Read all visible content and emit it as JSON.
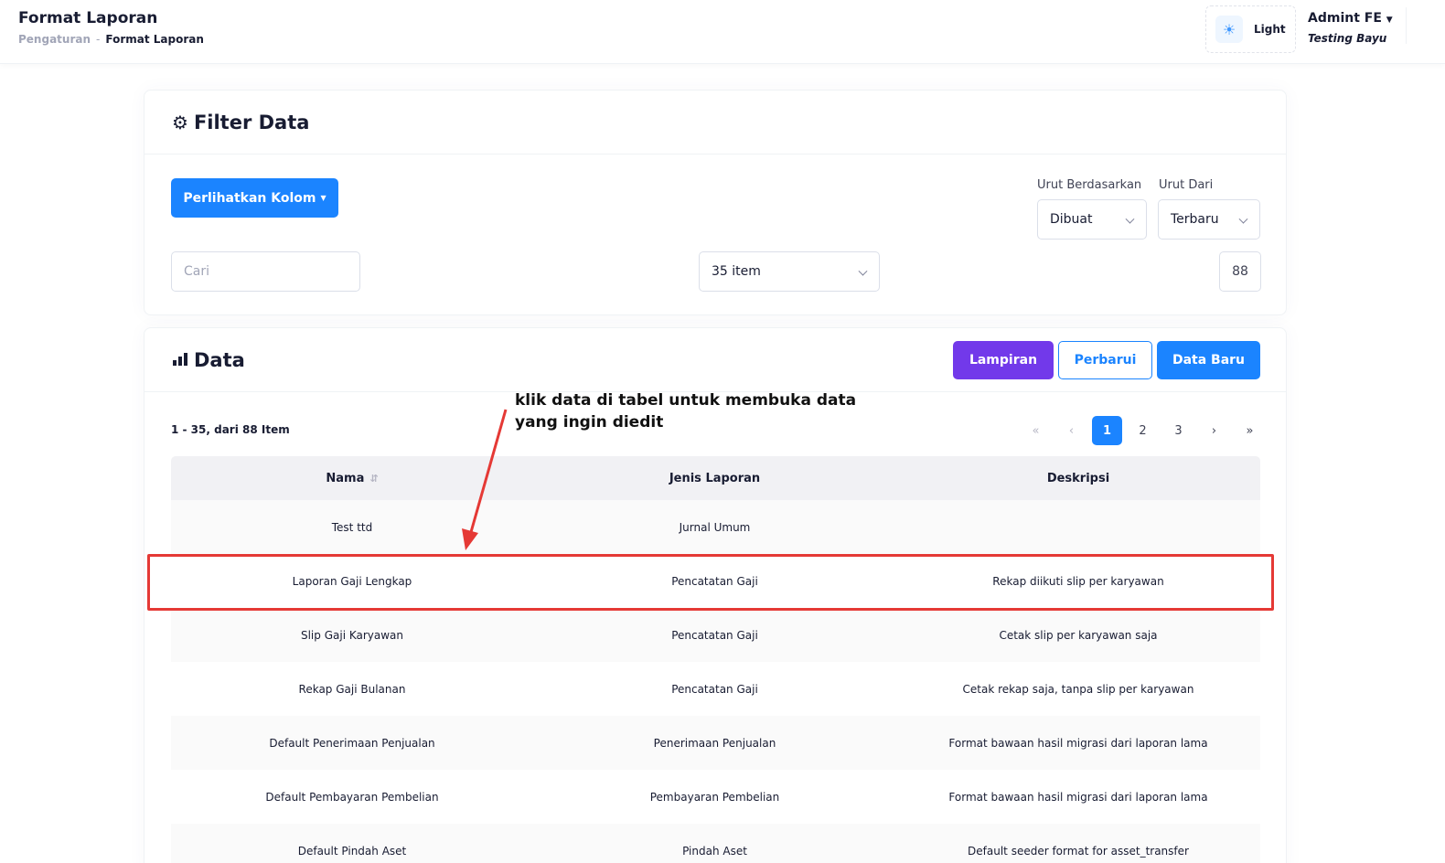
{
  "header": {
    "title": "Format Laporan",
    "breadcrumb": {
      "parent": "Pengaturan",
      "separator": "-",
      "current": "Format Laporan"
    },
    "theme": {
      "icon": "sun-icon",
      "label": "Light"
    },
    "user": {
      "name": "Admint FE",
      "subtitle": "Testing Bayu"
    }
  },
  "filter": {
    "title": "Filter Data",
    "icon": "gear-icon",
    "columns_button": "Perlihatkan Kolom",
    "sort_by": {
      "label": "Urut Berdasarkan",
      "value": "Dibuat"
    },
    "sort_order": {
      "label": "Urut Dari",
      "value": "Terbaru"
    },
    "search": {
      "placeholder": "Cari",
      "value": ""
    },
    "per_page": "35 item",
    "total": "88"
  },
  "data": {
    "title": "Data",
    "icon": "bar-chart-icon",
    "buttons": {
      "attachment": "Lampiran",
      "refresh": "Perbarui",
      "new": "Data Baru"
    },
    "range_text": "1 - 35, dari 88 Item",
    "pagination": {
      "first": "«",
      "prev": "‹",
      "pages": [
        "1",
        "2",
        "3"
      ],
      "active": "1",
      "next": "›",
      "last": "»"
    },
    "columns": [
      "Nama",
      "Jenis Laporan",
      "Deskripsi"
    ],
    "rows": [
      [
        "Test ttd",
        "Jurnal Umum",
        ""
      ],
      [
        "Laporan Gaji Lengkap",
        "Pencatatan Gaji",
        "Rekap diikuti slip per karyawan"
      ],
      [
        "Slip Gaji Karyawan",
        "Pencatatan Gaji",
        "Cetak slip per karyawan saja"
      ],
      [
        "Rekap Gaji Bulanan",
        "Pencatatan Gaji",
        "Cetak rekap saja, tanpa slip per karyawan"
      ],
      [
        "Default Penerimaan Penjualan",
        "Penerimaan Penjualan",
        "Format bawaan hasil migrasi dari laporan lama"
      ],
      [
        "Default Pembayaran Pembelian",
        "Pembayaran Pembelian",
        "Format bawaan hasil migrasi dari laporan lama"
      ],
      [
        "Default Pindah Aset",
        "Pindah Aset",
        "Default seeder format for asset_transfer"
      ]
    ]
  },
  "annotation": {
    "text": "klik data di tabel untuk membuka data yang ingin diedit",
    "color": "#e53935"
  }
}
